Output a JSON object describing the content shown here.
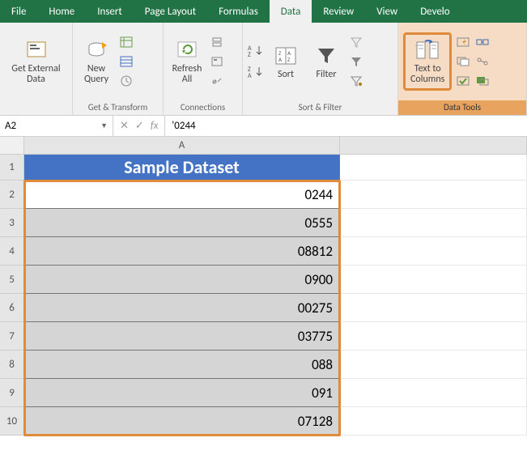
{
  "tabs": {
    "file": "File",
    "home": "Home",
    "insert": "Insert",
    "page_layout": "Page Layout",
    "formulas": "Formulas",
    "data": "Data",
    "review": "Review",
    "view": "View",
    "develo": "Develo"
  },
  "ribbon": {
    "ext": {
      "label": "Get External\nData"
    },
    "newq": {
      "label": "New\nQuery"
    },
    "getxform": "Get & Transform",
    "refresh": {
      "label": "Refresh\nAll"
    },
    "connections": "Connections",
    "sort": "Sort",
    "filter": "Filter",
    "sortfilter": "Sort & Filter",
    "text_to_columns": "Text to\nColumns",
    "data_tools": "Data Tools"
  },
  "formula_bar": {
    "name": "A2",
    "fx": "fx",
    "value": "'0244"
  },
  "grid": {
    "col_a": "A",
    "header_cell": "Sample Dataset",
    "rows": [
      "0244",
      "0555",
      "08812",
      "0900",
      "00275",
      "03775",
      "088",
      "091",
      "07128"
    ]
  }
}
